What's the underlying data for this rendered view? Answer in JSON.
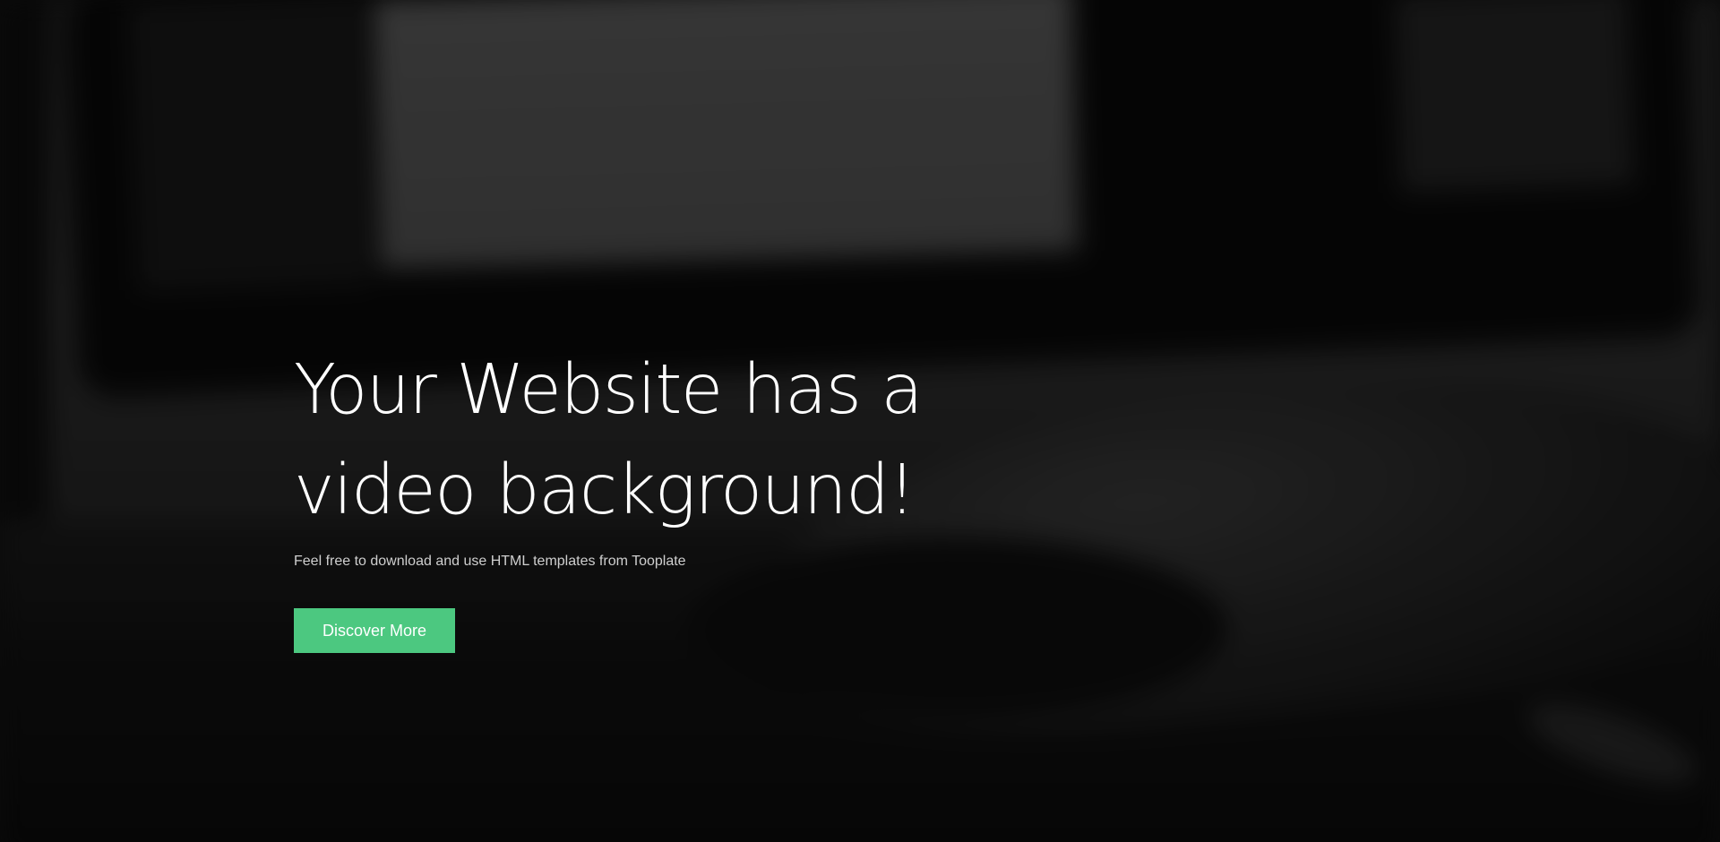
{
  "hero": {
    "headline_line1": "Your Website has a",
    "headline_line2": "video background!",
    "subtext": "Feel free to download and use HTML templates from Tooplate",
    "cta_label": "Discover More"
  },
  "colors": {
    "cta_background": "#4cc880",
    "headline_text": "#ffffff",
    "background": "#0d0d0d"
  }
}
